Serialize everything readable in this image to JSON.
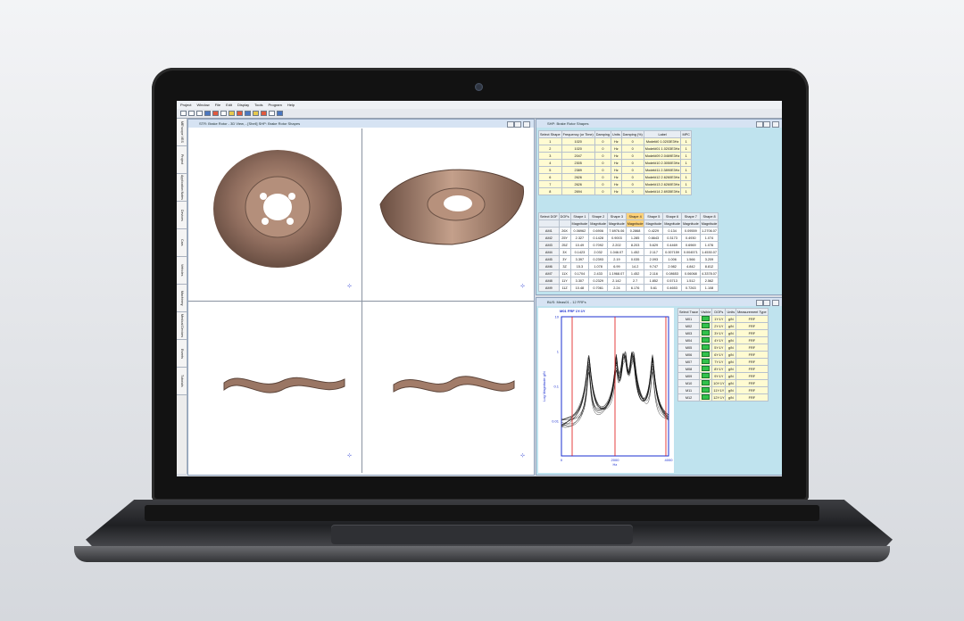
{
  "app": {
    "menu": [
      "Project",
      "Window",
      "File",
      "Edit",
      "Display",
      "Tools",
      "Program",
      "Help"
    ],
    "vertical_tabs": [
      "ME'scope VES",
      "Project",
      "Application Notes",
      "Devices",
      "Cars",
      "Vehicles",
      "Machinery",
      "Medical Devices",
      "Events",
      "Tutorials"
    ]
  },
  "view3d_window": {
    "title": "STR: Brake Rotor - 3D View, - [Shell] SHP: Brake Rotor Shapes"
  },
  "shapes_window": {
    "title": "SHP: Brake Rotor Shapes",
    "columns": [
      "Select Shape",
      "Frequency (or Time)",
      "Damping",
      "Units",
      "Damping (%)",
      "Label",
      "MPC"
    ],
    "rows": [
      [
        "1",
        "1020",
        "0",
        "Hz",
        "0",
        "Model#0 1.0203E3Hz",
        "1"
      ],
      [
        "2",
        "1020",
        "0",
        "Hz",
        "0",
        "Model#01 1.0203E3Hz",
        "1"
      ],
      [
        "3",
        "2047",
        "0",
        "Hz",
        "0",
        "Model#09 2.0469E3Hz",
        "1"
      ],
      [
        "4",
        "2305",
        "0",
        "Hz",
        "0",
        "Model#10 2.3050E3Hz",
        "1"
      ],
      [
        "5",
        "2389",
        "0",
        "Hz",
        "0",
        "Model#11 2.3890E3Hz",
        "1"
      ],
      [
        "6",
        "2626",
        "0",
        "Hz",
        "0",
        "Model#12 2.6260E3Hz",
        "1"
      ],
      [
        "7",
        "2626",
        "0",
        "Hz",
        "0",
        "Model#13 2.6260E3Hz",
        "1"
      ],
      [
        "8",
        "2694",
        "0",
        "Hz",
        "0",
        "Model#14 2.6935E3Hz",
        "1"
      ]
    ],
    "dof_columns": [
      "Select DOF",
      "DOFs",
      "Shape 1",
      "Shape 2",
      "Shape 3",
      "Shape 4",
      "Shape 5",
      "Shape 6",
      "Shape 7",
      "Shape 8"
    ],
    "dof_subheader": "Magnitude",
    "dof_rows": [
      [
        "AM1",
        "26X",
        "0.06962",
        "0.6906",
        "7.6976.06",
        "0.2868",
        "0.4229",
        "0.134",
        "0.09559",
        "1.2706.07"
      ],
      [
        "AM2",
        "25Y",
        "2.327",
        "0.1428",
        "0.9003",
        "1.285",
        "0.6643",
        "0.3173",
        "0.4930",
        "1.074"
      ],
      [
        "AM3",
        "25Z",
        "10.49",
        "0.7092",
        "2.202",
        "8.203",
        "5.629",
        "0.4469",
        "0.6969",
        "1.076"
      ],
      [
        "AM4",
        "3X",
        "0.1423",
        "2.032",
        "1.046.07",
        "1.452",
        "2.117",
        "0.007159",
        "0.004571",
        "1.4530.07"
      ],
      [
        "AM5",
        "3Y",
        "3.397",
        "0.2393",
        "2.19",
        "0.035",
        "2.093",
        "1.006",
        "1.566",
        "3.209"
      ],
      [
        "AM6",
        "3Z",
        "15.3",
        "1.078",
        "6.99",
        "14.2",
        "9.747",
        "2.982",
        "4.842",
        "8.812"
      ],
      [
        "AM7",
        "11X",
        "0.1704",
        "2.433",
        "1.1968.07",
        "1.452",
        "2.116",
        "0.08653",
        "0.06068",
        "4.3378.07"
      ],
      [
        "AM8",
        "11Y",
        "3.307",
        "0.2329",
        "2.142",
        "2.7",
        "1.852",
        "0.5713",
        "1.512",
        "2.562"
      ],
      [
        "AM9",
        "11Z",
        "10.48",
        "0.7061",
        "2.24",
        "6.176",
        "5.61",
        "0.4653",
        "0.7263",
        "1.108"
      ]
    ]
  },
  "bus_window": {
    "title": "BUS: Meas01 - 12 FRFs",
    "chart_header": "M01 FRF 1Y:1Y",
    "columns": [
      "Select Trace",
      "Visible",
      "DOFs",
      "Units",
      "Measurement Type"
    ],
    "rows": [
      [
        "M01",
        "Yes",
        "1Y:1Y",
        "g/N",
        "FRF"
      ],
      [
        "M02",
        "Yes",
        "2Y:1Y",
        "g/N",
        "FRF"
      ],
      [
        "M03",
        "Yes",
        "3Y:1Y",
        "g/N",
        "FRF"
      ],
      [
        "M04",
        "Yes",
        "4Y:1Y",
        "g/N",
        "FRF"
      ],
      [
        "M05",
        "Yes",
        "5Y:1Y",
        "g/N",
        "FRF"
      ],
      [
        "M06",
        "Yes",
        "6Y:1Y",
        "g/N",
        "FRF"
      ],
      [
        "M07",
        "Yes",
        "7Y:1Y",
        "g/N",
        "FRF"
      ],
      [
        "M08",
        "Yes",
        "8Y:1Y",
        "g/N",
        "FRF"
      ],
      [
        "M09",
        "Yes",
        "9Y:1Y",
        "g/N",
        "FRF"
      ],
      [
        "M10",
        "Yes",
        "10Y:1Y",
        "g/N",
        "FRF"
      ],
      [
        "M11",
        "Yes",
        "11Y:1Y",
        "g/N",
        "FRF"
      ],
      [
        "M12",
        "Yes",
        "12Y:1Y",
        "g/N",
        "FRF"
      ]
    ]
  },
  "chart_data": {
    "type": "line",
    "title": "M01 FRF 1Y:1Y",
    "xlabel": "Hz",
    "ylabel": "Log Magnitude g/N",
    "xlim": [
      0,
      4000
    ],
    "ylim": [
      0.001,
      10
    ],
    "yscale": "log",
    "x_ticks": [
      "0",
      "2000",
      "4000"
    ],
    "y_ticks": [
      "10",
      "1",
      "0.1",
      "0.01"
    ],
    "cursor_x": [
      400,
      2000,
      3900
    ],
    "peak_frequencies_hz": [
      1020,
      2047,
      2305,
      2389,
      2626,
      2694,
      3400
    ]
  }
}
